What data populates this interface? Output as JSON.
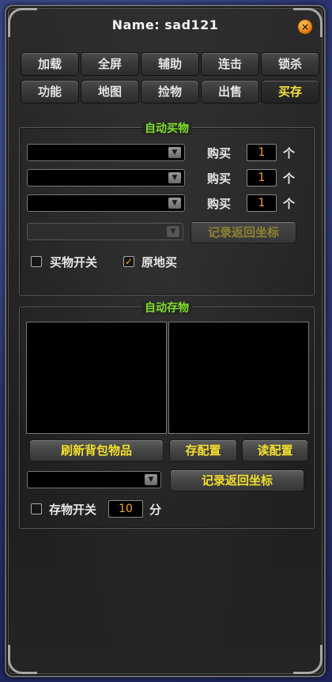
{
  "window": {
    "title": "Name:  sad121",
    "close_glyph": "×"
  },
  "tabs": {
    "row1": [
      "加载",
      "全屏",
      "辅助",
      "连击",
      "锁杀"
    ],
    "row2": [
      "功能",
      "地图",
      "捡物",
      "出售",
      "买存"
    ],
    "active": "买存"
  },
  "auto_buy": {
    "title": "自动买物",
    "items": [
      {
        "buy_label": "购买",
        "qty": "1",
        "unit": "个"
      },
      {
        "buy_label": "购买",
        "qty": "1",
        "unit": "个"
      },
      {
        "buy_label": "购买",
        "qty": "1",
        "unit": "个"
      }
    ],
    "record_button": "记录返回坐标",
    "buy_switch": {
      "label": "买物开关",
      "checked": false
    },
    "buy_in_place": {
      "label": "原地买",
      "checked": true,
      "check_glyph": "✓"
    }
  },
  "auto_store": {
    "title": "自动存物",
    "refresh_button": "刷新背包物品",
    "save_config_button": "存配置",
    "load_config_button": "读配置",
    "record_button": "记录返回坐标",
    "store_switch": {
      "label": "存物开关",
      "checked": false
    },
    "interval": {
      "value": "10",
      "unit": "分"
    }
  },
  "icons": {
    "dropdown_arrow": "▼"
  },
  "colors": {
    "accent_yellow": "#f3df2a",
    "legend_green": "#7ee02a",
    "number_orange": "#f4a23a"
  }
}
